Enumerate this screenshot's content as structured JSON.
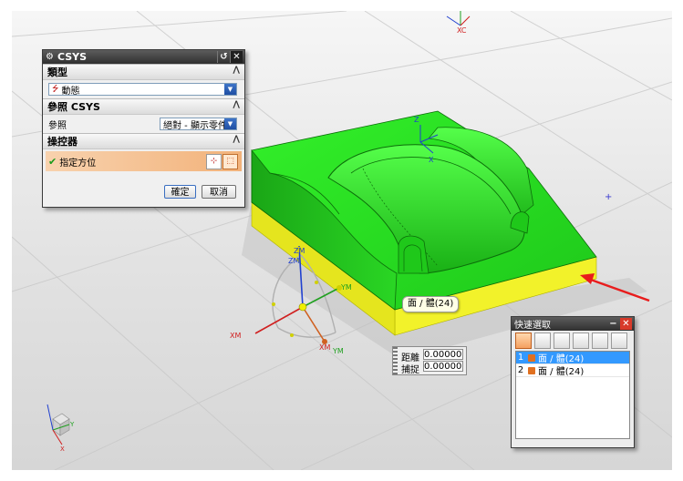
{
  "csys_dialog": {
    "title": "CSYS",
    "section_type": "類型",
    "type_value": "動態",
    "section_reference": "參照 CSYS",
    "reference_label": "參照",
    "reference_value": "絕對 - 顯示零件",
    "section_manipulator": "操控器",
    "specify_orientation": "指定方位",
    "ok_label": "確定",
    "cancel_label": "取消"
  },
  "quick_pick": {
    "title": "快速選取",
    "items": [
      {
        "num": "1",
        "label": "面 / 體(24)",
        "selected": true
      },
      {
        "num": "2",
        "label": "面 / 體(24)",
        "selected": false
      }
    ]
  },
  "tooltip": "面 / 體(24)",
  "snap_panel": {
    "distance_label": "距離",
    "distance_value": "0.00000",
    "snap_label": "捕捉",
    "snap_value": "0.00000"
  },
  "axis_labels": {
    "xc": "XC",
    "zm": "ZM",
    "ym_top": "YM",
    "xm_left": "XM",
    "xm_bottom": "XM",
    "ym_bottom": "YM",
    "z_small": "Z",
    "x_small": "X",
    "y_triad": "Y",
    "x_triad": "X"
  },
  "colors": {
    "part_green": "#26e01f",
    "part_yellow": "#f2f22a",
    "dialog_accent": "#f2b27a",
    "selection_blue": "#3399ff",
    "arrow_red": "#e81c1c"
  }
}
